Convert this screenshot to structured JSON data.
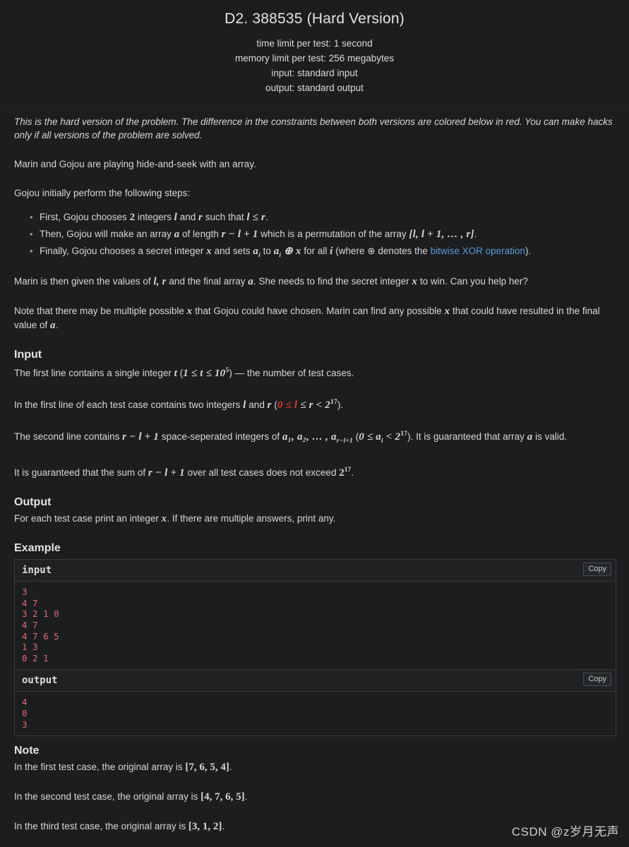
{
  "header": {
    "title": "D2. 388535 (Hard Version)",
    "time_limit": "time limit per test: 1 second",
    "memory_limit": "memory limit per test: 256 megabytes",
    "input_spec": "input: standard input",
    "output_spec": "output: standard output"
  },
  "statement": {
    "intro": "This is the hard version of the problem. The difference in the constraints between both versions are colored below in red. You can make hacks only if all versions of the problem are solved.",
    "para_marin": "Marin and Gojou are playing hide-and-seek with an array.",
    "para_steps_lead": "Gojou initially perform the following steps:",
    "steps": [
      {
        "t1": "First, Gojou chooses ",
        "n2": "2",
        "t3": " integers ",
        "m4": "l",
        "t5": " and ",
        "m6": "r",
        "t7": " such that ",
        "m8": "l ≤ r",
        "t9": "."
      },
      {
        "t1": "Then, Gojou will make an array ",
        "m2": "a",
        "t3": " of length ",
        "m4": "r − l + 1",
        "t5": " which is a permutation of the array ",
        "m6": "[l, l + 1, … , r]",
        "t7": "."
      },
      {
        "t1": "Finally, Gojou chooses a secret integer ",
        "m2": "x",
        "t3": " and sets ",
        "m4": "a",
        "m4sub": "i",
        "t5": " to ",
        "m6": "a",
        "m6sub": "i",
        "m6b": " ⊕ x",
        "t7": " for all ",
        "m8": "i",
        "t9": " (where ⊕ denotes the ",
        "link": "bitwise XOR operation",
        "t11": ")."
      }
    ],
    "para_marin_given_1": "Marin is then given the values of ",
    "para_marin_given_m": "l, r",
    "para_marin_given_2": " and the final array ",
    "para_marin_given_a": "a",
    "para_marin_given_3": ". She needs to find the secret integer ",
    "para_marin_given_x": "x",
    "para_marin_given_4": " to win. Can you help her?",
    "para_note_1": "Note that there may be multiple possible ",
    "para_note_x1": "x",
    "para_note_2": " that Gojou could have chosen. Marin can find any possible ",
    "para_note_x2": "x",
    "para_note_3": " that could have resulted in the final value of ",
    "para_note_a": "a",
    "para_note_4": "."
  },
  "input_section": {
    "heading": "Input",
    "line1_a": "The first line contains a single integer ",
    "line1_t": "t",
    "line1_b": " (",
    "line1_range": "1 ≤ t ≤ 10",
    "line1_sup": "5",
    "line1_c": ") — the number of test cases.",
    "line2_a": "In the first line of each test case contains two integers ",
    "line2_l": "l",
    "line2_b": " and ",
    "line2_r": "r",
    "line2_c": " (",
    "line2_red": "0 ≤ l",
    "line2_rest": " ≤ r < 2",
    "line2_sup": "17",
    "line2_d": ").",
    "line3_a": "The second line contains ",
    "line3_len": "r − l + 1",
    "line3_b": " space-seperated integers of ",
    "line3_arr": "a₁, a₂, … , a",
    "line3_arr_sub": "r−l+1",
    "line3_c": " (",
    "line3_range": "0 ≤ a",
    "line3_range_sub": "i",
    "line3_range2": " < 2",
    "line3_sup": "17",
    "line3_d": "). It is guaranteed that array ",
    "line3_a2": "a",
    "line3_e": " is valid.",
    "line4_a": "It is guaranteed that the sum of ",
    "line4_len": "r − l + 1",
    "line4_b": " over all test cases does not exceed ",
    "line4_pow": "2",
    "line4_sup": "17",
    "line4_c": "."
  },
  "output_section": {
    "heading": "Output",
    "line_a": "For each test case print an integer ",
    "line_x": "x",
    "line_b": ". If there are multiple answers, print any."
  },
  "example_section": {
    "heading": "Example",
    "input_label": "input",
    "output_label": "output",
    "copy_label": "Copy",
    "input_text": "3\n4 7\n3 2 1 0\n4 7\n4 7 6 5\n1 3\n0 2 1",
    "output_text": "4\n0\n3"
  },
  "note_section": {
    "heading": "Note",
    "n1_a": "In the first test case, the original array is ",
    "n1_arr": "[7, 6, 5, 4]",
    "n1_b": ".",
    "n2_a": "In the second test case, the original array is ",
    "n2_arr": "[4, 7, 6, 5]",
    "n2_b": ".",
    "n3_a": "In the third test case, the original array is ",
    "n3_arr": "[3, 1, 2]",
    "n3_b": "."
  },
  "watermark": "CSDN @z岁月无声",
  "colors": {
    "background": "#1b1d1f",
    "text": "#d8d8d4",
    "red_constraint": "#e2392e",
    "link": "#5b9bd5",
    "code": "#e06c75",
    "border": "#3a3d40"
  }
}
